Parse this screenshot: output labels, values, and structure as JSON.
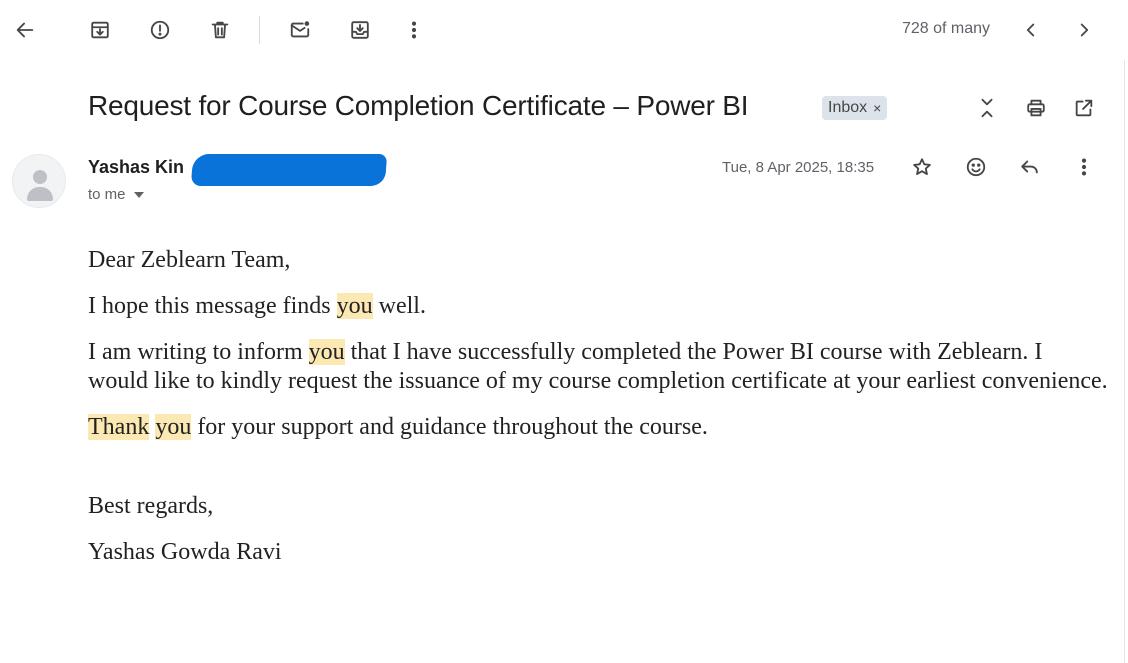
{
  "toolbar": {
    "back": "back-icon",
    "archive": "archive-icon",
    "report_spam": "report-spam-icon",
    "delete": "delete-icon",
    "mark_unread": "mark-unread-icon",
    "move_to": "move-to-icon",
    "more": "more-vert-icon",
    "page_count": "728 of many",
    "prev": "chevron-left-icon",
    "next": "chevron-right-icon"
  },
  "email": {
    "subject": "Request for Course Completion Certificate – Power BI",
    "label": "Inbox",
    "label_close": "×",
    "sender_name": "Yashas Kin",
    "recipient": "to me",
    "date": "Tue, 8 Apr 2025, 18:35",
    "body": {
      "greeting": "Dear Zeblearn Team,",
      "p1_before": "I hope this message finds ",
      "p1_highlight": "you",
      "p1_after": " well.",
      "p2_before": "I am writing to inform ",
      "p2_highlight": "you",
      "p2_after": " that I have successfully completed the Power BI course with Zeblearn. I would like to kindly request the issuance of my course completion certificate at your earliest convenience.",
      "p3_highlight1": "Thank",
      "p3_space": " ",
      "p3_highlight2": "you",
      "p3_after": " for your support and guidance throughout the course.",
      "closing": "Best regards,",
      "signature": "Yashas Gowda Ravi"
    }
  },
  "colors": {
    "highlight": "#fce8b2",
    "redaction": "#0a73d9",
    "label_chip": "#dde3ea"
  }
}
